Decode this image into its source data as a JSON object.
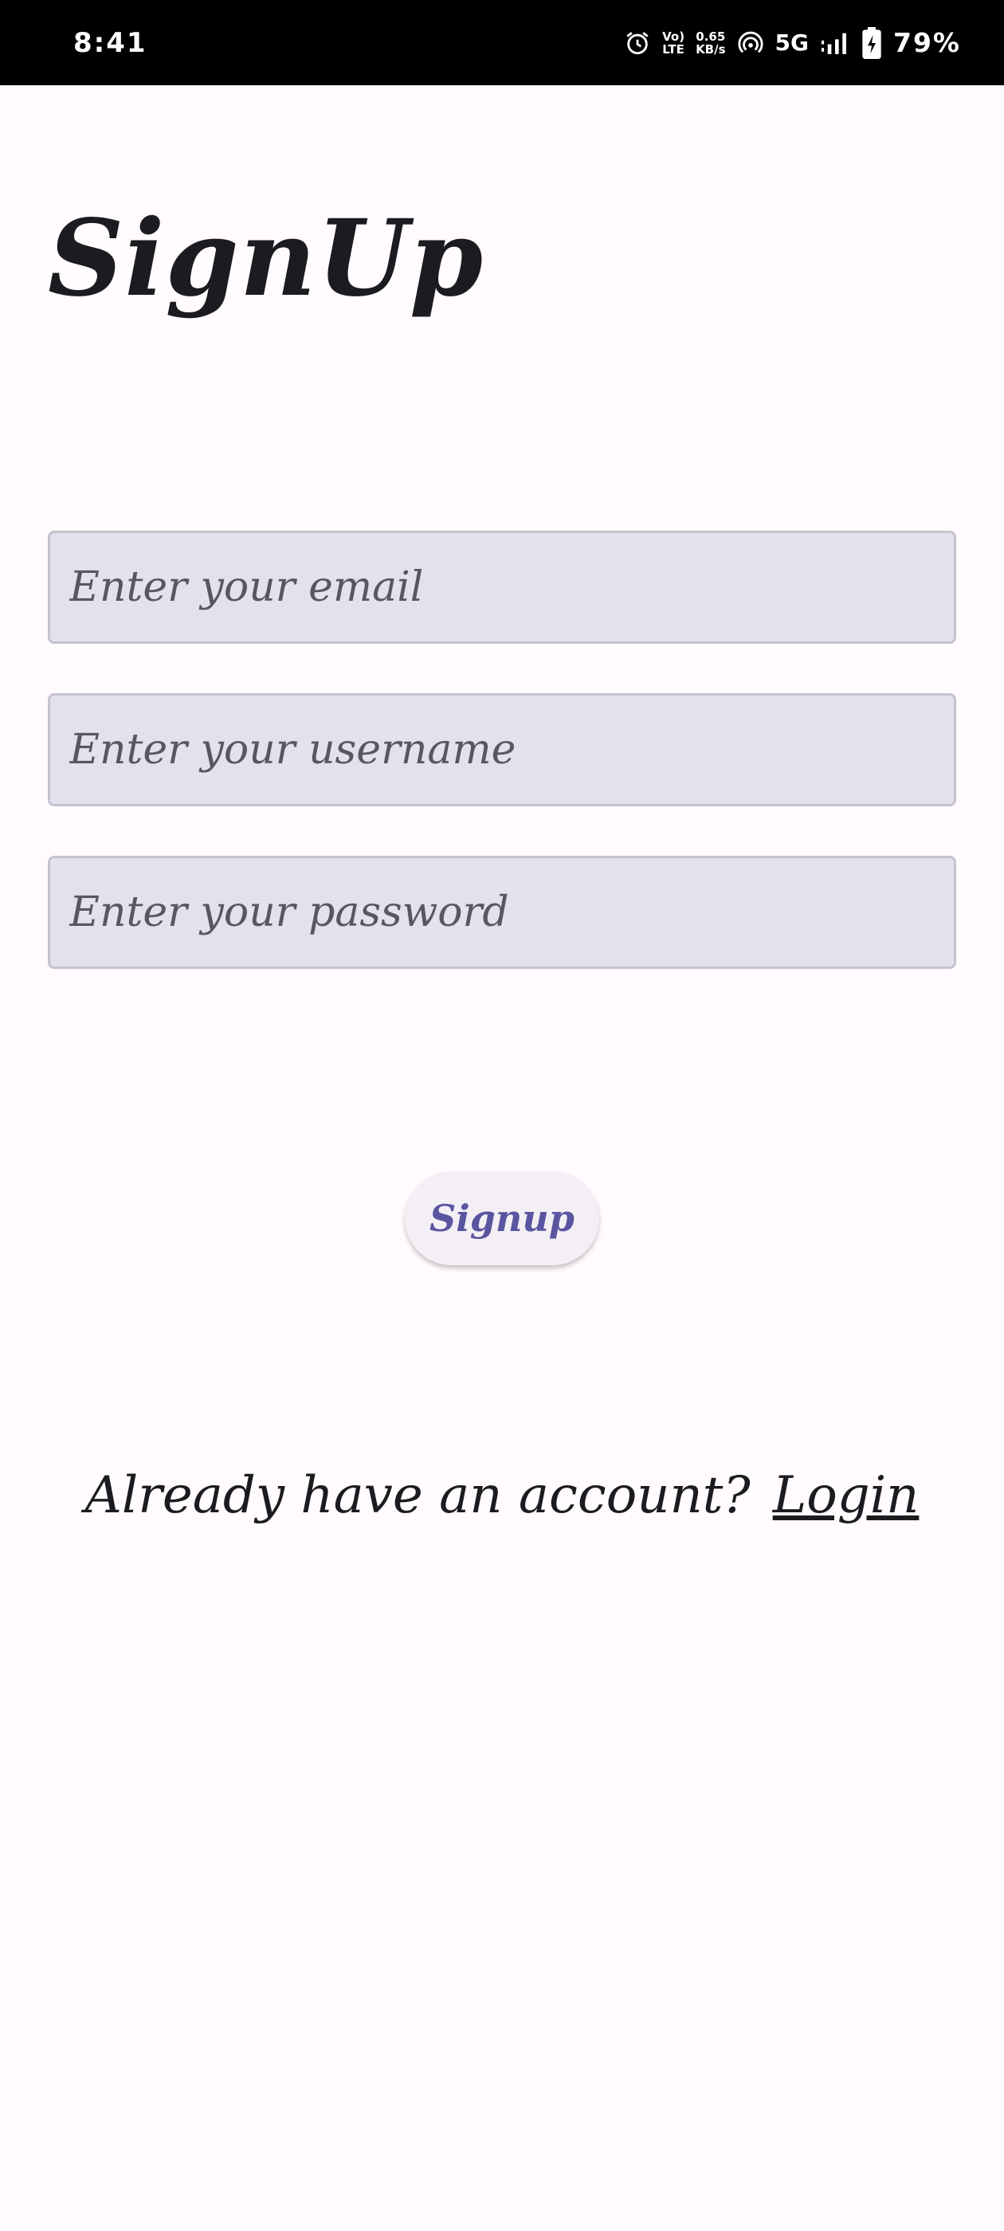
{
  "status_bar": {
    "time": "8:41",
    "volte_top": "Vo)",
    "volte_bottom": "LTE",
    "speed_top": "0.65",
    "speed_bottom": "KB/s",
    "network": "5G",
    "battery": "79%",
    "icons": [
      "alarm-icon",
      "volte-icon",
      "hotspot-icon",
      "signal-icon",
      "battery-charging-icon"
    ]
  },
  "title": "SignUp",
  "form": {
    "email_placeholder": "Enter your email",
    "username_placeholder": "Enter your username",
    "password_placeholder": "Enter your password",
    "email_value": "",
    "username_value": "",
    "password_value": ""
  },
  "signup_button": "Signup",
  "footer": {
    "prompt": "Already have an account?",
    "login_link": "Login"
  },
  "colors": {
    "background": "#fffbfe",
    "field_fill": "#e3e1ec",
    "button_text": "#5a55a0"
  }
}
